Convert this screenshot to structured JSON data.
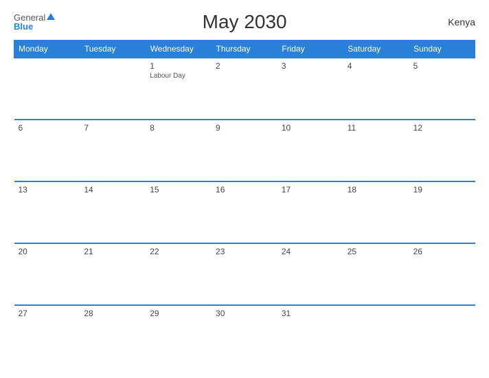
{
  "header": {
    "title": "May 2030",
    "country": "Kenya",
    "logo_general": "General",
    "logo_blue": "Blue"
  },
  "weekdays": [
    "Monday",
    "Tuesday",
    "Wednesday",
    "Thursday",
    "Friday",
    "Saturday",
    "Sunday"
  ],
  "weeks": [
    [
      {
        "day": "",
        "empty": true
      },
      {
        "day": "",
        "empty": true
      },
      {
        "day": "1",
        "event": "Labour Day"
      },
      {
        "day": "2"
      },
      {
        "day": "3"
      },
      {
        "day": "4"
      },
      {
        "day": "5"
      }
    ],
    [
      {
        "day": "6"
      },
      {
        "day": "7"
      },
      {
        "day": "8"
      },
      {
        "day": "9"
      },
      {
        "day": "10"
      },
      {
        "day": "11"
      },
      {
        "day": "12"
      }
    ],
    [
      {
        "day": "13"
      },
      {
        "day": "14"
      },
      {
        "day": "15"
      },
      {
        "day": "16"
      },
      {
        "day": "17"
      },
      {
        "day": "18"
      },
      {
        "day": "19"
      }
    ],
    [
      {
        "day": "20"
      },
      {
        "day": "21"
      },
      {
        "day": "22"
      },
      {
        "day": "23"
      },
      {
        "day": "24"
      },
      {
        "day": "25"
      },
      {
        "day": "26"
      }
    ],
    [
      {
        "day": "27"
      },
      {
        "day": "28"
      },
      {
        "day": "29"
      },
      {
        "day": "30"
      },
      {
        "day": "31"
      },
      {
        "day": "",
        "empty": true
      },
      {
        "day": "",
        "empty": true
      }
    ]
  ]
}
